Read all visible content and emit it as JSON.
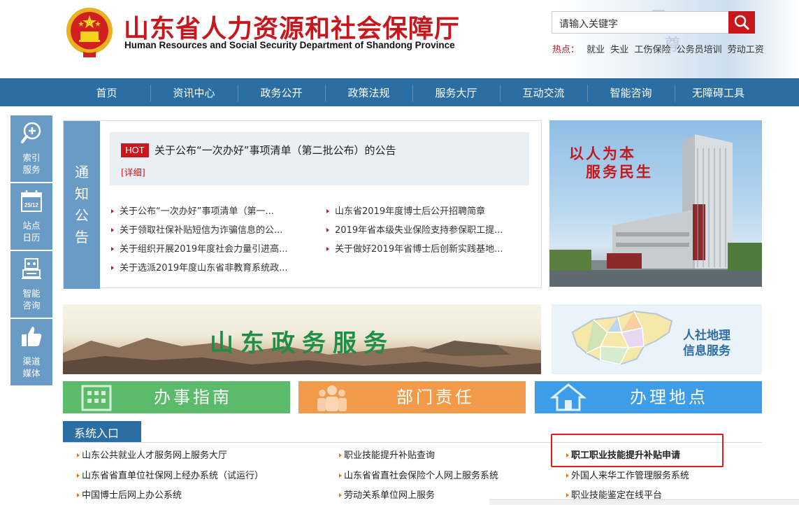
{
  "header": {
    "title": "山东省人力资源和社会保障厅",
    "subtitle": "Human Resources and Social Security Department of Shandong Province",
    "search_placeholder": "请输入关键字",
    "hot_label": "热点：",
    "hot_words": [
      "就业",
      "失业",
      "工伤保险",
      "公务员培训",
      "劳动工资"
    ]
  },
  "nav": [
    "首页",
    "资讯中心",
    "政务公开",
    "政策法规",
    "服务大厅",
    "互动交流",
    "智能咨询",
    "无障碍工具"
  ],
  "sidebar": [
    {
      "line1": "索引",
      "line2": "服务",
      "icon": "search-plus-icon"
    },
    {
      "line1": "站点",
      "line2": "日历",
      "icon": "calendar-icon",
      "date": "25/12"
    },
    {
      "line1": "智能",
      "line2": "咨询",
      "icon": "robot-icon"
    },
    {
      "line1": "渠道",
      "line2": "媒体",
      "icon": "thumbs-up-icon"
    }
  ],
  "notice": {
    "tab_chars": [
      "通",
      "知",
      "公",
      "告"
    ],
    "hot_badge": "HOT",
    "hot_title": "关于公布“一次办好”事项清单（第二批公布）的公告",
    "detail_link": "[详细]",
    "left_items": [
      "关于公布“一次办好”事项清单（第一...",
      "关于领取社保补贴短信为诈骗信息的公...",
      "关于组织开展2019年度社会力量引进高...",
      "关于选派2019年度山东省非教育系统政..."
    ],
    "right_items": [
      "山东省2019年度博士后公开招聘简章",
      "2019年省本级失业保险支持参保职工提...",
      "关于做好2019年省博士后创新实践基地..."
    ]
  },
  "feature_image": {
    "slogan_line1": "以人为本",
    "slogan_line2": "服务民生"
  },
  "banners": {
    "gov_service": "山东政务服务",
    "map_line1": "人社地理",
    "map_line2": "信息服务"
  },
  "tiles": [
    {
      "label": "办事指南",
      "color": "#5cbb6a",
      "icon": "building-icon"
    },
    {
      "label": "部门责任",
      "color": "#f39a4a",
      "icon": "people-icon"
    },
    {
      "label": "办理地点",
      "color": "#3d9de8",
      "icon": "home-icon"
    }
  ],
  "systems": {
    "tab": "系统入口",
    "col1": [
      "山东公共就业人才服务网上服务大厅",
      "山东省省直单位社保网上经办系统（试运行）",
      "中国博士后网上办公系统"
    ],
    "col2": [
      "职业技能提升补贴查询",
      "山东省省直社会保险个人网上服务系统",
      "劳动关系单位网上服务"
    ],
    "col3": [
      "职工职业技能提升补贴申请",
      "外国人来华工作管理服务系统",
      "职业技能鉴定在线平台"
    ]
  },
  "colors": {
    "brand_red": "#c8161d",
    "nav_blue": "#2a6ea4",
    "side_blue": "#6a9bc6"
  }
}
